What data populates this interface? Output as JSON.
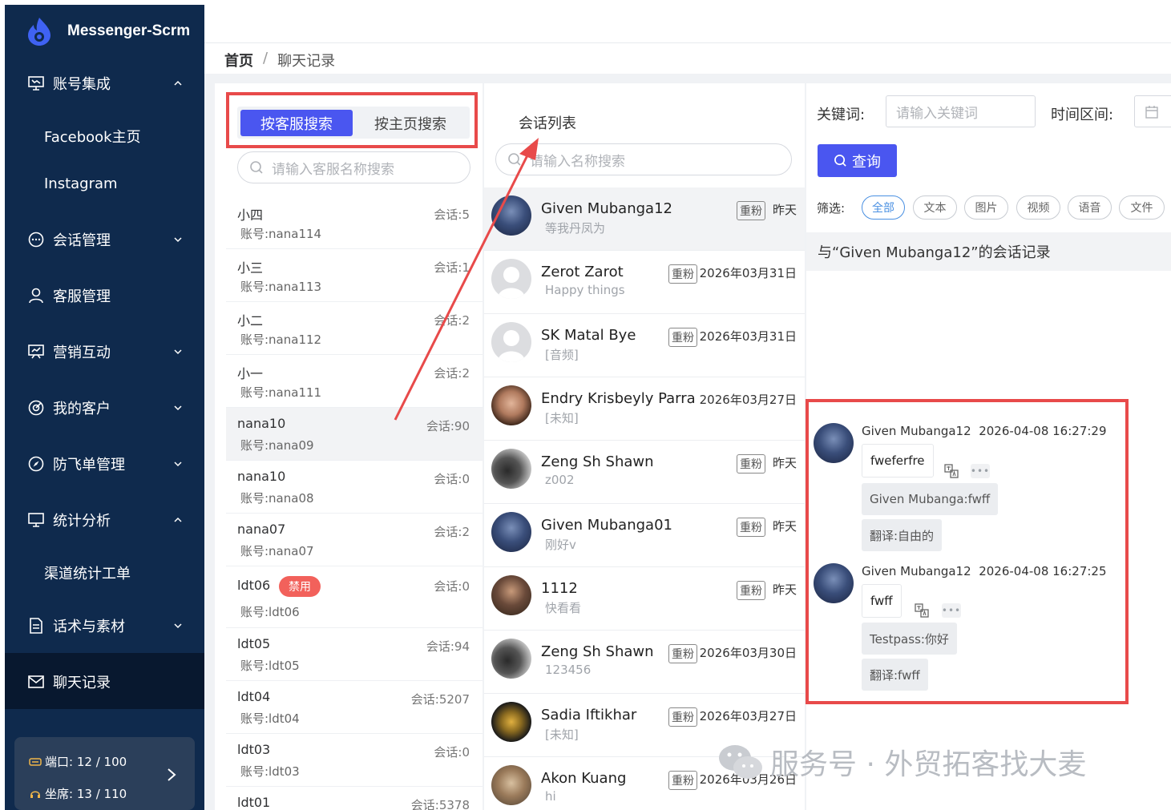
{
  "app": {
    "title": "Messenger-Scrm"
  },
  "sidebar": {
    "items": [
      {
        "label": "账号集成",
        "icon": "monitor-icon",
        "expanded": true
      },
      {
        "label": "会话管理",
        "icon": "chat-icon"
      },
      {
        "label": "客服管理",
        "icon": "user-icon"
      },
      {
        "label": "营销互动",
        "icon": "presentation-icon"
      },
      {
        "label": "我的客户",
        "icon": "target-icon"
      },
      {
        "label": "防飞单管理",
        "icon": "compass-icon"
      },
      {
        "label": "统计分析",
        "icon": "screen-icon",
        "expanded": true
      },
      {
        "label": "话术与素材",
        "icon": "document-icon"
      },
      {
        "label": "聊天记录",
        "icon": "mail-icon",
        "active": true
      }
    ],
    "sub_account": [
      "Facebook主页",
      "Instagram"
    ],
    "sub_stats": [
      "渠道统计工单"
    ],
    "footer": {
      "port_label": "端口:",
      "port_value": "12 / 100",
      "seat_label": "坐席:",
      "seat_value": "13 / 110"
    }
  },
  "breadcrumb": {
    "home": "首页",
    "sep": "/",
    "current": "聊天记录"
  },
  "left_panel": {
    "tabs": [
      "按客服搜索",
      "按主页搜索"
    ],
    "search_placeholder": "请输入客服名称搜索",
    "agents": [
      {
        "name": "小四",
        "account": "账号:nana114",
        "sessions": "会话:5"
      },
      {
        "name": "小三",
        "account": "账号:nana113",
        "sessions": "会话:1"
      },
      {
        "name": "小二",
        "account": "账号:nana112",
        "sessions": "会话:2"
      },
      {
        "name": "小一",
        "account": "账号:nana111",
        "sessions": "会话:2"
      },
      {
        "name": "nana10",
        "account": "账号:nana09",
        "sessions": "会话:90"
      },
      {
        "name": "nana10",
        "account": "账号:nana08",
        "sessions": "会话:0"
      },
      {
        "name": "nana07",
        "account": "账号:nana07",
        "sessions": "会话:2"
      },
      {
        "name": "ldt06",
        "account": "账号:ldt06",
        "sessions": "会话:0",
        "badge": "禁用"
      },
      {
        "name": "ldt05",
        "account": "账号:ldt05",
        "sessions": "会话:94"
      },
      {
        "name": "ldt04",
        "account": "账号:ldt04",
        "sessions": "会话:5207"
      },
      {
        "name": "ldt03",
        "account": "账号:ldt03",
        "sessions": "会话:0"
      },
      {
        "name": "ldt01",
        "account": "",
        "sessions": "会话:5378"
      }
    ]
  },
  "mid_panel": {
    "title": "会话列表",
    "search_placeholder": "请输入名称搜索",
    "conversations": [
      {
        "name": "Given Mubanga12",
        "sub": "等我丹凤为",
        "tag": "重粉",
        "time": "昨天"
      },
      {
        "name": "Zerot Zarot",
        "sub": "Happy things",
        "tag": "重粉",
        "time": "2026年03月31日"
      },
      {
        "name": "SK Matal Bye",
        "sub": "[音频]",
        "tag": "重粉",
        "time": "2026年03月31日"
      },
      {
        "name": "Endry Krisbeyly Parra",
        "sub": "[未知]",
        "tag": "",
        "time": "2026年03月27日"
      },
      {
        "name": "Zeng Sh Shawn",
        "sub": "z002",
        "tag": "重粉",
        "time": "昨天"
      },
      {
        "name": "Given Mubanga01",
        "sub": "刚好v",
        "tag": "重粉",
        "time": "昨天"
      },
      {
        "name": "1112",
        "sub": "快看看",
        "tag": "重粉",
        "time": "昨天"
      },
      {
        "name": "Zeng Sh Shawn",
        "sub": "123456",
        "tag": "重粉",
        "time": "2026年03月30日"
      },
      {
        "name": "Sadia Iftikhar",
        "sub": "[未知]",
        "tag": "重粉",
        "time": "2026年03月27日"
      },
      {
        "name": "Akon Kuang",
        "sub": "hi",
        "tag": "重粉",
        "time": "2026年03月26日"
      }
    ]
  },
  "right_panel": {
    "keyword_label": "关键词:",
    "keyword_placeholder": "请输入关键词",
    "time_label": "时间区间:",
    "query_label": "查询",
    "filter_label": "筛选:",
    "filters": [
      "全部",
      "文本",
      "图片",
      "视频",
      "语音",
      "文件"
    ],
    "conv_header": "与“Given Mubanga12”的会话记录",
    "messages": [
      {
        "sender": "Given Mubanga12",
        "time": "2026-04-08 16:27:29",
        "text": "fweferfre",
        "reply": "Given Mubanga:fwff",
        "translation": "翻译:自由的"
      },
      {
        "sender": "Given Mubanga12",
        "time": "2026-04-08 16:27:25",
        "text": "fwff",
        "reply": "Testpass:你好",
        "translation": "翻译:fwff"
      }
    ]
  },
  "watermark": "服务号 · 外贸拓客找大麦",
  "colors": {
    "sidebar": "#0f2a4d",
    "accent": "#4a56f0",
    "annotation": "#e84a4a"
  }
}
